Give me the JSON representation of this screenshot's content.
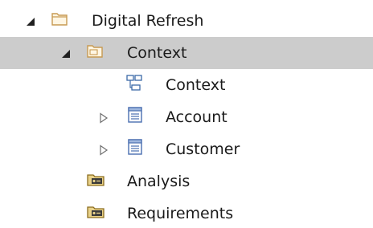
{
  "tree": {
    "nodes": [
      {
        "label": "Digital Refresh",
        "icon": "folder-icon",
        "expander": "expanded"
      },
      {
        "label": "Context",
        "icon": "package-icon",
        "expander": "expanded",
        "selected": true
      },
      {
        "label": "Context",
        "icon": "diagram-icon",
        "expander": "none"
      },
      {
        "label": "Account",
        "icon": "class-element-icon",
        "expander": "collapsed"
      },
      {
        "label": "Customer",
        "icon": "class-element-icon",
        "expander": "collapsed"
      },
      {
        "label": "Analysis",
        "icon": "view-package-icon",
        "expander": "none"
      },
      {
        "label": "Requirements",
        "icon": "view-package-icon",
        "expander": "none"
      }
    ]
  },
  "colors": {
    "selection": "#cccccc",
    "text": "#1a1a1a",
    "folder": "#c79a52",
    "class_icon": "#4a6fb0",
    "view_icon": "#b8943b"
  }
}
